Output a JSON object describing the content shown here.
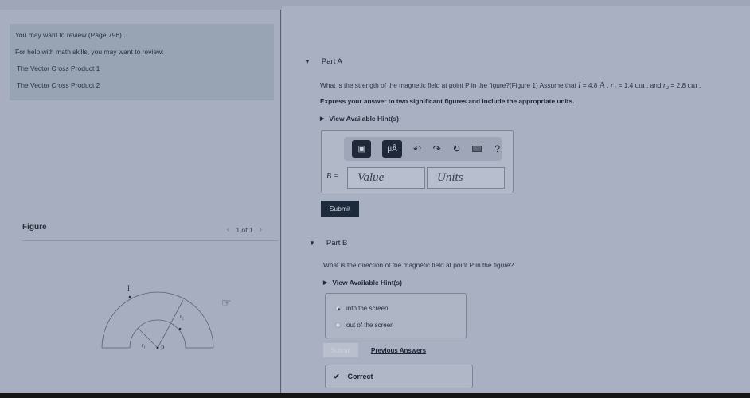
{
  "review": {
    "line1": "You may want to review (Page 796) .",
    "line2": "For help with math skills, you may want to review:",
    "links": [
      "The Vector Cross Product 1",
      "The Vector Cross Product 2"
    ]
  },
  "figure": {
    "title": "Figure",
    "pager": "1 of 1",
    "prev_icon": "chevron-left-icon",
    "next_icon": "chevron-right-icon",
    "labels": {
      "current": "I",
      "r1": "r₁",
      "r2": "r₂",
      "point": "P"
    }
  },
  "part_a": {
    "title": "Part A",
    "question_prefix": "What is the strength of the magnetic field at point P in the figure?(Figure 1) Assume that ",
    "var_I": "I",
    "val_I": " = 4.8 ",
    "unit_A": "A",
    "sep1": " , ",
    "var_r1": "r₁",
    "val_r1": " = 1.4 ",
    "unit_cm1": "cm",
    "sep2": " , and ",
    "var_r2": "r₂",
    "val_r2": " = 2.8 ",
    "unit_cm2": "cm",
    "end": " .",
    "instruction": "Express your answer to two significant figures and include the appropriate units.",
    "hint": "View Available Hint(s)",
    "toolbar": {
      "templates": "templates-icon",
      "units_label": "μÅ",
      "undo": "↶",
      "redo": "↷",
      "reset": "↻",
      "keyboard": "keyboard-icon",
      "help": "?"
    },
    "answer_label": "B =",
    "value_placeholder": "Value",
    "units_placeholder": "Units",
    "submit": "Submit"
  },
  "part_b": {
    "title": "Part B",
    "question": "What is the direction of the magnetic field at point P in the figure?",
    "hint": "View Available Hint(s)",
    "options": [
      {
        "label": "into the screen",
        "selected": true
      },
      {
        "label": "out of the screen",
        "selected": false
      }
    ],
    "submit": "Submit",
    "previous_answers": "Previous Answers",
    "result": "Correct",
    "result_icon": "✔"
  }
}
